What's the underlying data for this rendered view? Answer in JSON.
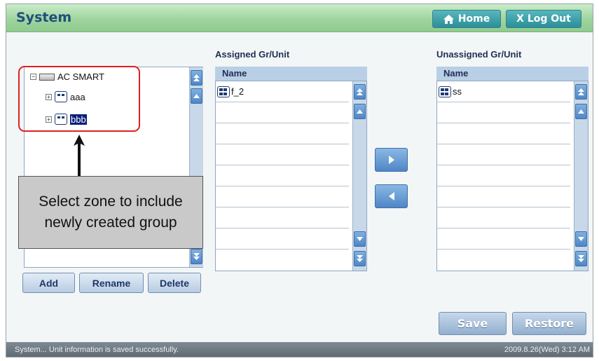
{
  "header": {
    "title": "System",
    "home_label": "Home",
    "logout_label": "X Log Out"
  },
  "tree": {
    "root": "AC SMART",
    "children": [
      {
        "label": "aaa",
        "selected": false
      },
      {
        "label": "bbb",
        "selected": true
      }
    ]
  },
  "callout_text": "Select zone to include newly created group",
  "tree_buttons": {
    "add": "Add",
    "rename": "Rename",
    "delete": "Delete"
  },
  "assigned": {
    "title": "Assigned Gr/Unit",
    "column": "Name",
    "items": [
      "f_2"
    ]
  },
  "unassigned": {
    "title": "Unassigned Gr/Unit",
    "column": "Name",
    "items": [
      "ss"
    ]
  },
  "actions": {
    "save": "Save",
    "restore": "Restore"
  },
  "status": {
    "message": "System... Unit information is saved successfully.",
    "timestamp": "2009.8.26(Wed)  3:12 AM"
  },
  "colors": {
    "header_green": "#9fd49f",
    "title_blue": "#1f4f7a",
    "accent_teal": "#2a8f99",
    "highlight_red": "#e02020",
    "selection_navy": "#0a1f7a"
  }
}
